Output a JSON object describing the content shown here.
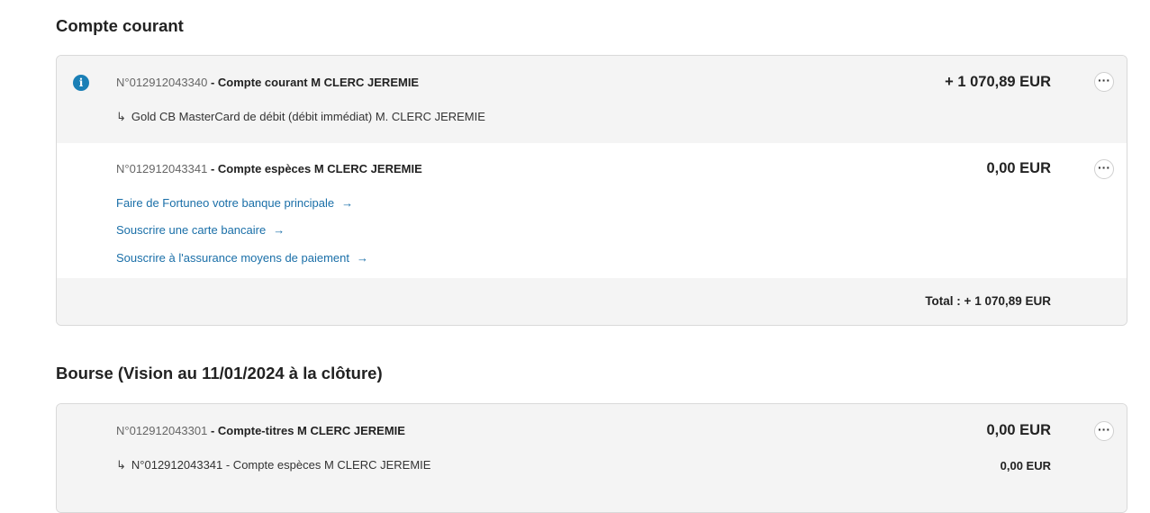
{
  "sections": {
    "courant": {
      "title": "Compte courant",
      "account1": {
        "number": "N°012912043340",
        "separator": " - ",
        "name": "Compte courant M CLERC JEREMIE",
        "amount": "+ 1 070,89 EUR",
        "sub_arrow": "↳",
        "sub": "Gold CB MasterCard de débit (débit immédiat) M. CLERC JEREMIE",
        "info_icon": "info-icon",
        "more_label": "···"
      },
      "account2": {
        "number": "N°012912043341",
        "separator": " - ",
        "name": "Compte espèces M CLERC JEREMIE",
        "amount": "0,00 EUR",
        "more_label": "···"
      },
      "links": [
        {
          "label": "Faire de Fortuneo votre banque principale",
          "arrow": "→"
        },
        {
          "label": "Souscrire une carte bancaire",
          "arrow": "→"
        },
        {
          "label": "Souscrire à l'assurance moyens de paiement",
          "arrow": "→"
        }
      ],
      "total": "Total : + 1 070,89 EUR"
    },
    "bourse": {
      "title": "Bourse (Vision au 11/01/2024 à la clôture)",
      "account1": {
        "number": "N°012912043301",
        "separator": " - ",
        "name": "Compte-titres M CLERC JEREMIE",
        "amount": "0,00 EUR",
        "more_label": "···",
        "sub_arrow": "↳",
        "sub": "N°012912043341 - Compte espèces M CLERC JEREMIE",
        "sub_amount": "0,00 EUR"
      }
    }
  },
  "colors": {
    "link": "#1a6fa8",
    "info": "#1a7fb6",
    "row_gray": "#f4f4f4",
    "border": "#d9d9d9"
  }
}
